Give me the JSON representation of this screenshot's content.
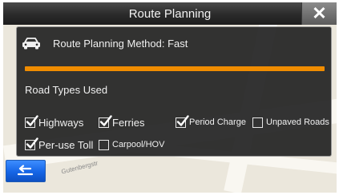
{
  "header": {
    "title": "Route Planning",
    "close_icon": "close-icon"
  },
  "route_method": {
    "icon": "car-icon",
    "label": "Route Planning Method: Fast"
  },
  "progress": {
    "value_percent": 100,
    "color": "#f08c00"
  },
  "road_types": {
    "title": "Road Types Used",
    "options": [
      {
        "label": "Highways",
        "checked": true
      },
      {
        "label": "Ferries",
        "checked": true
      },
      {
        "label": "Period Charge",
        "checked": true
      },
      {
        "label": "Unpaved Roads",
        "checked": false
      },
      {
        "label": "Per-use Toll",
        "checked": true
      },
      {
        "label": "Carpool/HOV",
        "checked": false
      }
    ]
  },
  "footer": {
    "back_icon": "back-arrow-icon"
  },
  "map": {
    "street_label": "Gutenbergstr"
  },
  "colors": {
    "panel_bg": "#262626",
    "accent_blue": "#1565e6",
    "progress": "#f08c00"
  }
}
